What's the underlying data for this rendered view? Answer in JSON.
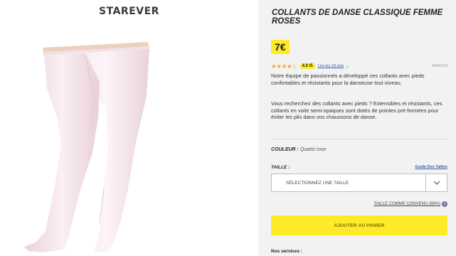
{
  "brand": "STAREVER",
  "product": {
    "title": "COLLANTS DE DANSE CLASSIQUE FEMME ROSES",
    "price": "7€",
    "rating_stars": "★★★★☆",
    "rating_score": "4.0 /5",
    "reviews_link": "Lire les 18 avis",
    "reference": "8490219",
    "description_1": "Notre équipe de passionnés a développé ces collants avec pieds confortables et résistants pour la danseuse tout niveau.",
    "description_2": "Vous recherchez des collants avec pieds ? Extensibles et résistants, ces collants en voile semi-opaques sont dotés de pointes pré-formées pour éviter les plis dans vos chaussons de danse."
  },
  "color": {
    "label": "COULEUR :",
    "value": "Quartz rose"
  },
  "size": {
    "label": "TAILLE :",
    "guide_link": "Guide Des Tailles",
    "select_placeholder": "SÉLECTIONNEZ UNE TAILLE",
    "fit_link": "TAILLE COMME CONVENU (86%)"
  },
  "cart": {
    "add_button": "AJOUTER AU PANIER"
  },
  "services": {
    "label": "Nos services :"
  },
  "colors": {
    "accent_yellow": "#ffea28",
    "link_blue": "#2f5ca8",
    "star_orange": "#f5a623",
    "tights_pink": "#f6e6ec"
  },
  "icons": {
    "select_arrow": "chevron-down-icon",
    "info": "info-icon"
  }
}
